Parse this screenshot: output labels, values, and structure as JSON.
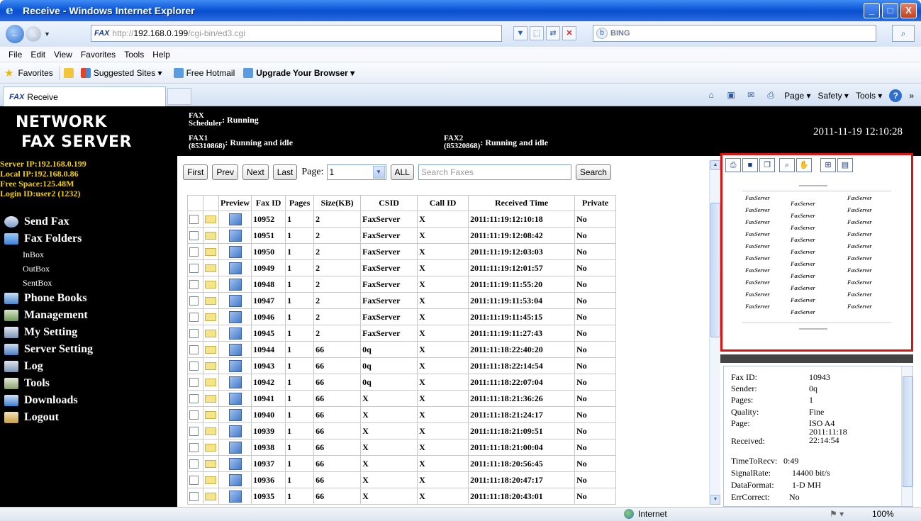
{
  "window": {
    "title": "Receive - Windows Internet Explorer",
    "minimize": "_",
    "maximize": "□",
    "close": "X"
  },
  "address": {
    "badge": "FAX",
    "url_prefix": "http://",
    "url_host": "192.168.0.199",
    "url_path": "/cgi-bin/ed3.cgi",
    "search_engine": "BING",
    "search_icon": "magnifier-icon"
  },
  "menu": [
    "File",
    "Edit",
    "View",
    "Favorites",
    "Tools",
    "Help"
  ],
  "favorites_bar": {
    "favorites": "Favorites",
    "suggested": "Suggested Sites ▾",
    "hotmail": "Free Hotmail",
    "upgrade": "Upgrade Your Browser ▾"
  },
  "tab": {
    "badge": "FAX",
    "label": "Receive"
  },
  "command_bar": {
    "page": "Page ▾",
    "safety": "Safety ▾",
    "tools": "Tools ▾",
    "more": "»"
  },
  "header": {
    "brand_line1": "NETWORK",
    "brand_line2": "FAX SERVER",
    "scheduler_label_1": "FAX",
    "scheduler_label_2": "Scheduler",
    "scheduler_value": ": Running",
    "fax1_label_1": "FAX1",
    "fax1_label_2": "(85310868)",
    "fax1_value": ": Running and idle",
    "fax2_label_1": "FAX2",
    "fax2_label_2": "(85320868)",
    "fax2_value": ": Running and idle",
    "datetime": "2011-11-19 12:10:28"
  },
  "server_info": {
    "server_ip": "Server IP:192.168.0.199",
    "local_ip": "Local IP:192.168.0.86",
    "free_space": "Free Space:125.48M",
    "login_id": "Login ID:user2 (1232)"
  },
  "nav": {
    "send_fax": "Send Fax",
    "fax_folders": "Fax Folders",
    "inbox": "InBox",
    "outbox": "OutBox",
    "sentbox": "SentBox",
    "phone_books": "Phone Books",
    "management": "Management",
    "my_setting": "My Setting",
    "server_setting": "Server Setting",
    "log": "Log",
    "tools": "Tools",
    "downloads": "Downloads",
    "logout": "Logout"
  },
  "pager": {
    "first": "First",
    "prev": "Prev",
    "next": "Next",
    "last": "Last",
    "page_label": "Page:",
    "page_value": "1",
    "all": "ALL",
    "search_placeholder": "Search Faxes",
    "search_button": "Search"
  },
  "table": {
    "headers": [
      "Preview",
      "Fax ID",
      "Pages",
      "Size(KB)",
      "CSID",
      "Call ID",
      "Received Time",
      "Private"
    ],
    "rows": [
      [
        "10952",
        "1",
        "2",
        "FaxServer",
        "X",
        "2011:11:19:12:10:18",
        "No"
      ],
      [
        "10951",
        "1",
        "2",
        "FaxServer",
        "X",
        "2011:11:19:12:08:42",
        "No"
      ],
      [
        "10950",
        "1",
        "2",
        "FaxServer",
        "X",
        "2011:11:19:12:03:03",
        "No"
      ],
      [
        "10949",
        "1",
        "2",
        "FaxServer",
        "X",
        "2011:11:19:12:01:57",
        "No"
      ],
      [
        "10948",
        "1",
        "2",
        "FaxServer",
        "X",
        "2011:11:19:11:55:20",
        "No"
      ],
      [
        "10947",
        "1",
        "2",
        "FaxServer",
        "X",
        "2011:11:19:11:53:04",
        "No"
      ],
      [
        "10946",
        "1",
        "2",
        "FaxServer",
        "X",
        "2011:11:19:11:45:15",
        "No"
      ],
      [
        "10945",
        "1",
        "2",
        "FaxServer",
        "X",
        "2011:11:19:11:27:43",
        "No"
      ],
      [
        "10944",
        "1",
        "66",
        "0q",
        "X",
        "2011:11:18:22:40:20",
        "No"
      ],
      [
        "10943",
        "1",
        "66",
        "0q",
        "X",
        "2011:11:18:22:14:54",
        "No"
      ],
      [
        "10942",
        "1",
        "66",
        "0q",
        "X",
        "2011:11:18:22:07:04",
        "No"
      ],
      [
        "10941",
        "1",
        "66",
        "X",
        "X",
        "2011:11:18:21:36:26",
        "No"
      ],
      [
        "10940",
        "1",
        "66",
        "X",
        "X",
        "2011:11:18:21:24:17",
        "No"
      ],
      [
        "10939",
        "1",
        "66",
        "X",
        "X",
        "2011:11:18:21:09:51",
        "No"
      ],
      [
        "10938",
        "1",
        "66",
        "X",
        "X",
        "2011:11:18:21:00:04",
        "No"
      ],
      [
        "10937",
        "1",
        "66",
        "X",
        "X",
        "2011:11:18:20:56:45",
        "No"
      ],
      [
        "10936",
        "1",
        "66",
        "X",
        "X",
        "2011:11:18:20:47:17",
        "No"
      ],
      [
        "10935",
        "1",
        "66",
        "X",
        "X",
        "2011:11:18:20:43:01",
        "No"
      ]
    ]
  },
  "preview": {
    "watermark_word": "FaxServer",
    "tools": [
      "print-icon",
      "save-icon",
      "copy-icon",
      "zoom-icon",
      "hand-icon",
      "fit-page-icon",
      "fit-width-icon"
    ]
  },
  "fax_info": {
    "labels": [
      "Fax ID:",
      "Sender:",
      "Pages:",
      "Quality:",
      "Page:",
      "Received:",
      "TimeToRecv:",
      "SignalRate:",
      "DataFormat:",
      "ErrCorrect:"
    ],
    "values": [
      "10943",
      "0q",
      "1",
      "Fine",
      "ISO A4",
      "2011:11:18 22:14:54",
      "0:49",
      "14400 bit/s",
      "1-D MH",
      "No"
    ]
  },
  "statusbar": {
    "zone": "Internet",
    "zoom": "100%"
  }
}
